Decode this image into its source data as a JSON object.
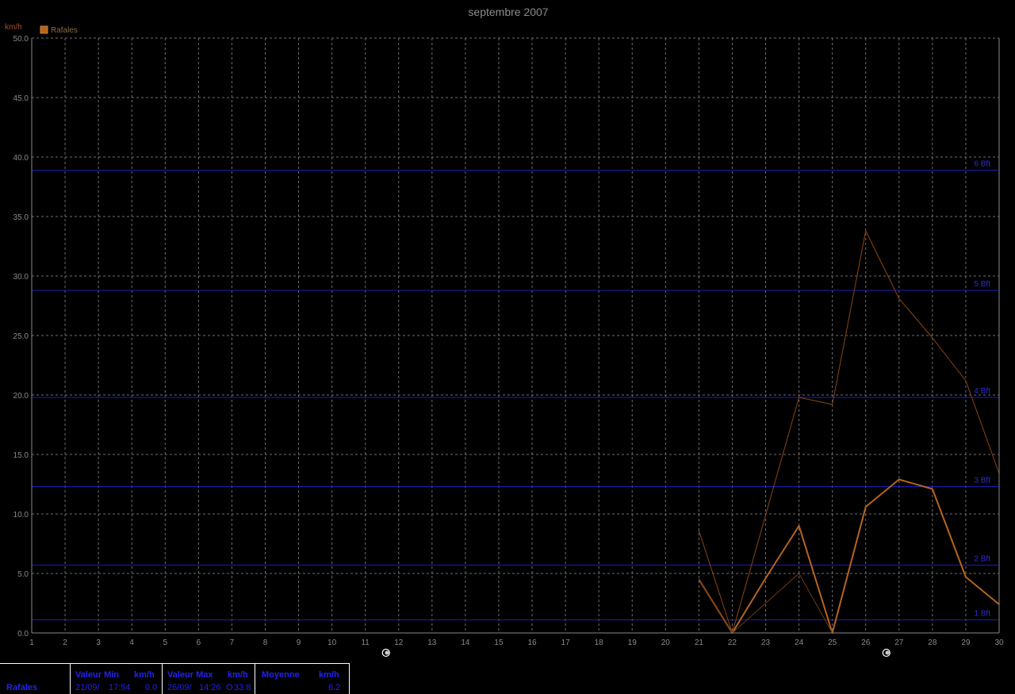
{
  "chart_data": {
    "type": "line",
    "title": "septembre 2007",
    "ylabel": "km/h",
    "xlim": [
      1,
      30
    ],
    "ylim": [
      0,
      50
    ],
    "x_ticks": [
      "1",
      "2",
      "3",
      "4",
      "5",
      "6",
      "7",
      "8",
      "9",
      "10",
      "11",
      "12",
      "13",
      "14",
      "15",
      "16",
      "17",
      "18",
      "19",
      "20",
      "21",
      "22",
      "23",
      "24",
      "25",
      "26",
      "27",
      "28",
      "29",
      "30"
    ],
    "y_ticks": [
      "0.0",
      "5.0",
      "10.0",
      "15.0",
      "20.0",
      "25.0",
      "30.0",
      "35.0",
      "40.0",
      "45.0",
      "50.0"
    ],
    "grid": true,
    "legend_position": "top-left",
    "series": [
      {
        "name": "Rafales",
        "color": "#b5651d",
        "x": [
          21,
          22,
          23,
          24,
          25,
          26,
          27,
          28,
          29,
          30
        ],
        "values": [
          4.5,
          0.0,
          4.6,
          9.0,
          0.0,
          10.6,
          12.9,
          12.1,
          4.7,
          2.4
        ]
      },
      {
        "color": "#8b4513",
        "x": [
          21,
          22,
          23,
          24,
          25,
          26,
          27,
          28,
          29,
          30
        ],
        "values": [
          8.6,
          0.0,
          9.9,
          19.8,
          19.2,
          33.8,
          28.1,
          24.8,
          21.2,
          13.4
        ]
      },
      {
        "color": "#6b3a13",
        "x": [
          21,
          22,
          23,
          24,
          25
        ],
        "values": [
          4.5,
          0.0,
          2.5,
          5.0,
          0.0
        ]
      }
    ],
    "beaufort_lines": [
      {
        "label": "1 Bft",
        "value": 1.1
      },
      {
        "label": "2 Bft",
        "value": 5.7
      },
      {
        "label": "3 Bft",
        "value": 12.3
      },
      {
        "label": "4 Bft",
        "value": 19.8
      },
      {
        "label": "5 Bft",
        "value": 28.8
      },
      {
        "label": "6 Bft",
        "value": 38.9
      }
    ],
    "colors": {
      "grid": "#6e6e6e",
      "beaufort": "#1a1ab8",
      "axis": "#888888"
    },
    "markers": [
      {
        "name": "moon-icon",
        "x": 12
      },
      {
        "name": "moon-icon",
        "x": 27
      }
    ]
  },
  "stats": {
    "label": "Rafales",
    "min_header": "Valeur Min",
    "min_unit": "km/h",
    "min_date": "21/09/",
    "min_time": "17:54",
    "min_value": "0.0",
    "max_header": "Valeur Max",
    "max_unit": "km/h",
    "max_date": "26/09/",
    "max_time": "14:26",
    "max_dir": "O",
    "max_value": "33.8",
    "avg_header": "Moyenne",
    "avg_unit": "km/h",
    "avg_value": "6.2"
  }
}
